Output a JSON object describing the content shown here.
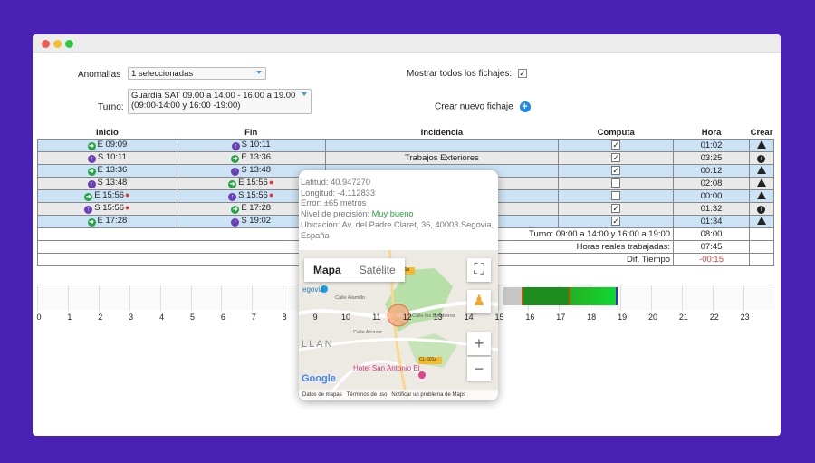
{
  "filters": {
    "anomalias_label": "Anomalías",
    "anomalias_value": "1 seleccionadas",
    "turno_label": "Turno:",
    "turno_value_line1": "Guardia SAT 09.00 a 14.00 - 16.00 a 19.00",
    "turno_value_line2": "(09:00-14:00 y 16:00 -19:00)",
    "mostrar_label": "Mostrar todos los fichajes:",
    "mostrar_checked": "✓",
    "crear_label": "Crear nuevo fichaje"
  },
  "table": {
    "headers": [
      "Inicio",
      "Fin",
      "Incidencia",
      "Computa",
      "Hora",
      "Crear"
    ],
    "rows": [
      {
        "inicio": "E 09:09",
        "inicio_icon": "arrow-right",
        "fin": "S 10:11",
        "fin_icon": "arrow-up",
        "incidencia": "",
        "computa": "✓",
        "hora": "01:02",
        "crear": "warning"
      },
      {
        "inicio": "S 10:11",
        "inicio_icon": "arrow-up",
        "fin": "E 13:36",
        "fin_icon": "arrow-right",
        "incidencia": "Trabajos Exteriores",
        "computa": "✓",
        "hora": "03:25",
        "crear": "info"
      },
      {
        "inicio": "E 13:36",
        "inicio_icon": "arrow-right",
        "fin": "S 13:48",
        "fin_icon": "arrow-up",
        "incidencia": "",
        "computa": "✓",
        "hora": "00:12",
        "crear": "warning"
      },
      {
        "inicio": "S 13:48",
        "inicio_icon": "arrow-up",
        "fin": "E 15:56",
        "fin_icon": "arrow-right",
        "incidencia": "",
        "computa": "",
        "hora": "02:08",
        "crear": "warning"
      },
      {
        "inicio": "E 15:56",
        "inicio_icon": "arrow-right",
        "fin": "S 15:56",
        "fin_icon": "arrow-up",
        "incidencia": "",
        "computa": "",
        "hora": "00:00",
        "crear": "warning"
      },
      {
        "inicio": "S 15:56",
        "inicio_icon": "arrow-up",
        "fin": "E 17:28",
        "fin_icon": "arrow-right",
        "incidencia": "",
        "computa": "✓",
        "hora": "01:32",
        "crear": "info"
      },
      {
        "inicio": "E 17:28",
        "inicio_icon": "arrow-right",
        "fin": "S 19:02",
        "fin_icon": "arrow-up",
        "incidencia": "",
        "computa": "✓",
        "hora": "01:34",
        "crear": "warning"
      }
    ],
    "summary": {
      "turno_label": "Turno:  09:00 a 14:00 y 16:00 a 19:00",
      "turno_value": "08:00",
      "horas_label": "Horas reales trabajadas:",
      "horas_value": "07:45",
      "dif_label": "Dif. Tiempo",
      "dif_value": "-00:15"
    }
  },
  "timeline": {
    "hours": [
      "0",
      "1",
      "2",
      "3",
      "4",
      "5",
      "6",
      "7",
      "8",
      "9",
      "10",
      "11",
      "12",
      "13",
      "14",
      "15",
      "16",
      "17",
      "18",
      "19",
      "20",
      "21",
      "22",
      "23"
    ]
  },
  "popup": {
    "latitud": "Latitud: 40.947270",
    "longitud": "Longitud: -4.112833",
    "error": "Error: ±65 metros",
    "precision_label": "Nivel de precisión:",
    "precision_value": "Muy bueno",
    "ubicacion": "Ubicación: Av. del Padre Claret, 36, 40003 Segovia, España",
    "map": {
      "tab_map": "Mapa",
      "tab_sat": "Satélite",
      "place1": "egovia",
      "place2": "Hotel San Antonio El",
      "road1": "CL-601a",
      "road2": "CL-601a",
      "street1": "Calle los Bomberos",
      "street2": "Calle Alamillo",
      "street3": "Calle Alcazar",
      "area": "LLAN",
      "footer_data": "Datos de mapas",
      "footer_terms": "Términos de uso",
      "footer_report": "Notificar un problema de Maps",
      "logo": "Google"
    }
  },
  "colors": {
    "background": "#4a22b3",
    "row_blue": "#cce3f5",
    "row_grey": "#e9e9e9",
    "bar_green": "#1e8c1e"
  }
}
